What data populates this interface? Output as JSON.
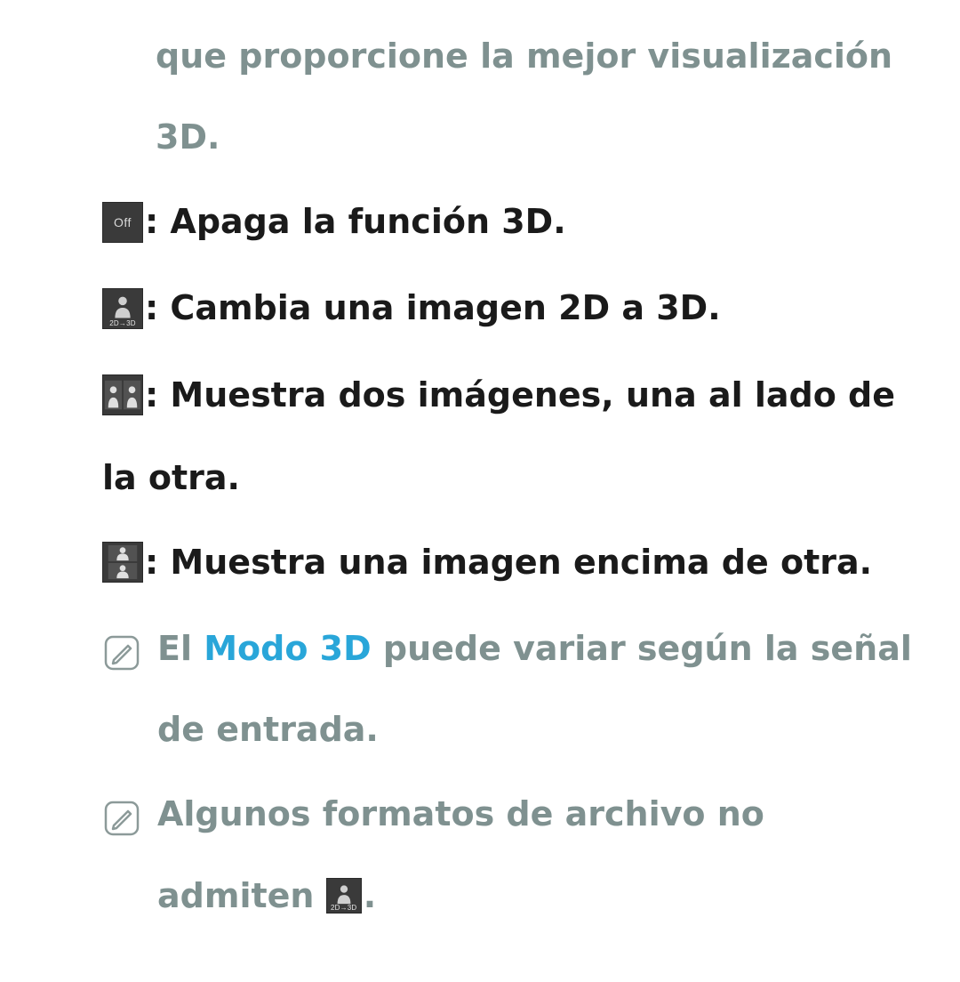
{
  "intro_fragment": "que proporcione la mejor visualización 3D.",
  "items": [
    {
      "icon_label": "Off",
      "desc": ": Apaga la función 3D."
    },
    {
      "icon_label": "2D→3D",
      "desc": ": Cambia una imagen 2D a 3D."
    },
    {
      "icon_label": "side-by-side",
      "desc": ": Muestra dos imágenes, una al lado de la otra."
    },
    {
      "icon_label": "top-bottom",
      "desc": ": Muestra una imagen encima de otra."
    }
  ],
  "notes": [
    {
      "pre": "El ",
      "kw": "Modo 3D",
      "post": " puede variar según la señal de entrada."
    },
    {
      "full_pre": "Algunos formatos de archivo no admiten ",
      "trailing_icon_label": "2D→3D",
      "full_post": "."
    }
  ]
}
